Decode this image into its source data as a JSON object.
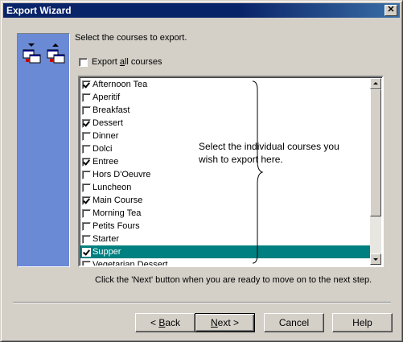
{
  "window": {
    "title": "Export Wizard",
    "close_glyph": "✕"
  },
  "instructions": "Select the courses to export.",
  "export_all": {
    "label_prefix": "Export ",
    "label_accel": "a",
    "label_suffix": "ll courses",
    "checked": false
  },
  "courses": [
    {
      "label": "Afternoon Tea",
      "checked": true,
      "selected": false
    },
    {
      "label": "Aperitif",
      "checked": false,
      "selected": false
    },
    {
      "label": "Breakfast",
      "checked": false,
      "selected": false
    },
    {
      "label": "Dessert",
      "checked": true,
      "selected": false
    },
    {
      "label": "Dinner",
      "checked": false,
      "selected": false
    },
    {
      "label": "Dolci",
      "checked": false,
      "selected": false
    },
    {
      "label": "Entree",
      "checked": true,
      "selected": false
    },
    {
      "label": "Hors D'Oeuvre",
      "checked": false,
      "selected": false
    },
    {
      "label": "Luncheon",
      "checked": false,
      "selected": false
    },
    {
      "label": "Main Course",
      "checked": true,
      "selected": false
    },
    {
      "label": "Morning Tea",
      "checked": false,
      "selected": false
    },
    {
      "label": "Petits Fours",
      "checked": false,
      "selected": false
    },
    {
      "label": "Starter",
      "checked": false,
      "selected": false
    },
    {
      "label": "Supper",
      "checked": true,
      "selected": true
    },
    {
      "label": "Vegetarian Dessert",
      "checked": false,
      "selected": false
    }
  ],
  "hint": "Select the individual courses you wish to export here.",
  "footnote": "Click the 'Next' button when you are ready to move on to the next step.",
  "buttons": {
    "back": {
      "prefix": "< ",
      "accel": "B",
      "rest": "ack"
    },
    "next": {
      "accel": "N",
      "rest": "ext >"
    },
    "cancel": "Cancel",
    "help": "Help"
  },
  "colors": {
    "title_bar": "#0a246a",
    "side_panel": "#6b8ad6",
    "selection": "#008080",
    "face": "#d4d0c8"
  },
  "icons": [
    "export-course-icon",
    "import-course-icon",
    "close-icon",
    "scroll-up-icon",
    "scroll-down-icon"
  ]
}
